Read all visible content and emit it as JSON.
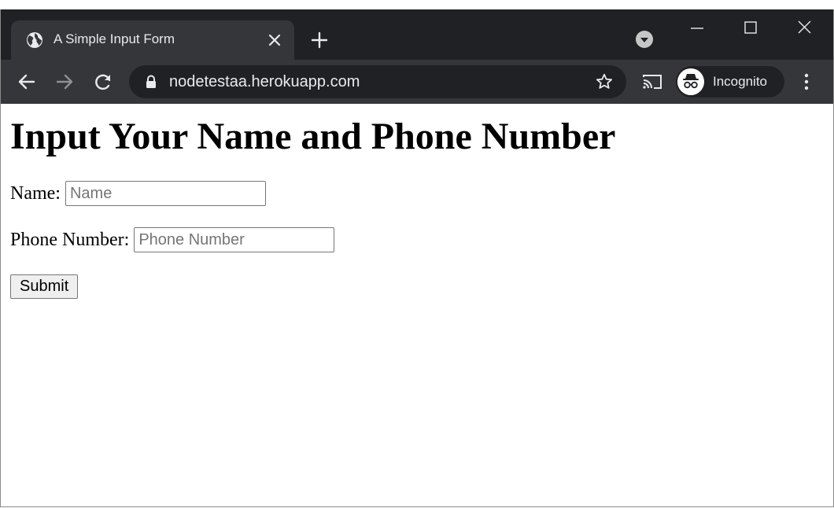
{
  "browser": {
    "tab": {
      "title": "A Simple Input Form",
      "favicon": "globe-icon"
    },
    "address_bar": {
      "url": "nodetestaa.herokuapp.com"
    },
    "profile": {
      "label": "Incognito"
    },
    "colors": {
      "tabstrip": "#202124",
      "toolbar": "#35363a",
      "text": "#e8eaed"
    }
  },
  "page": {
    "heading": "Input Your Name and Phone Number",
    "form": {
      "name_label": "Name:",
      "name_placeholder": "Name",
      "phone_label": "Phone Number:",
      "phone_placeholder": "Phone Number",
      "submit_label": "Submit"
    }
  }
}
